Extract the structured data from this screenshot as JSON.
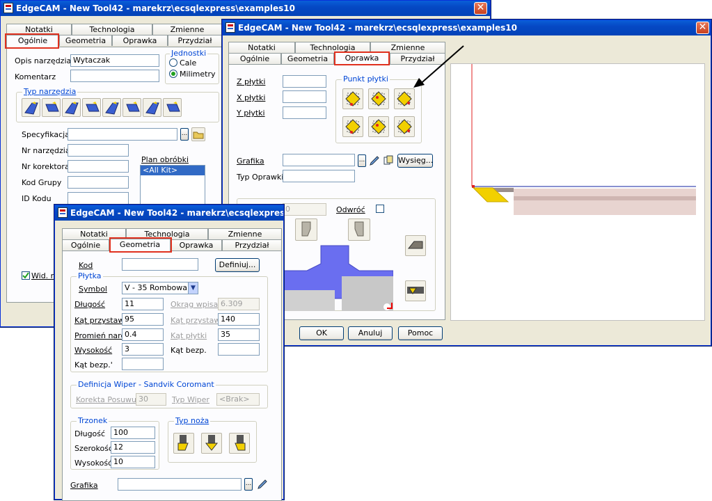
{
  "win1": {
    "title": "EdgeCAM - New Tool42 - marekrz\\ecsqlexpress\\examples10",
    "tabs_row1": [
      "Notatki",
      "Technologia",
      "Zmienne"
    ],
    "tabs_row2": [
      "Ogólnie",
      "Geometria",
      "Oprawka",
      "Przydział"
    ],
    "opis_label": "Opis narzędzia",
    "opis_value": "Wytaczak",
    "komentarz_label": "Komentarz",
    "jednostki_title": "Jednostki",
    "cale": "Cale",
    "milimetry": "Milimetry",
    "typ_title": "Typ narzędzia",
    "specyfikacja": "Specyfikacja",
    "nr_narzedzia": "Nr narzędzia",
    "nr_korektora": "Nr korektora",
    "kod_grupy": "Kod Grupy",
    "id_kodu": "ID Kodu",
    "plan_label": "Plan obróbki",
    "plan_item": "<All Kit>",
    "wid_label": "Wid. na",
    "dots": "..."
  },
  "win2": {
    "title": "EdgeCAM - New Tool42 - marekrz\\ecsqlexpress\\examples10",
    "tabs_row1": [
      "Notatki",
      "Technologia",
      "Zmienne"
    ],
    "tabs_row2": [
      "Ogólnie",
      "Geometria",
      "Oprawka",
      "Przydział"
    ],
    "z_plytki": "Z płytki",
    "x_plytki": "X płytki",
    "y_plytki": "Y płytki",
    "punkt_title": "Punkt płytki",
    "grafika": "Grafika",
    "typ_oprawki": "Typ Oprawki",
    "wysieg": "Wysięg...",
    "odwroc": "Odwróć",
    "partial_value": "0",
    "ok": "OK",
    "anuluj": "Anuluj",
    "pomoc": "Pomoc",
    "dots": "..."
  },
  "win3": {
    "title": "EdgeCAM - New Tool42 - marekrz\\ecsqlexpress\\examples10",
    "tabs_row1": [
      "Notatki",
      "Technologia",
      "Zmienne"
    ],
    "tabs_row2": [
      "Ogólnie",
      "Geometria",
      "Oprawka",
      "Przydział"
    ],
    "kod": "Kod",
    "definiuj": "Definiuj...",
    "plytka_title": "Płytka",
    "symbol": "Symbol",
    "symbol_value": "V - 35 Rombowa",
    "dlugosc": "Długość",
    "dlugosc_v": "11",
    "okrag": "Okrąg wpisany",
    "okrag_v": "6.309",
    "kat_przystaw": "Kąt przystaw.",
    "kat_przystaw_v": "95",
    "kat_przystaw2": "Kąt przystaw.",
    "kat_przystaw2_v": "140",
    "promien": "Promień naroża",
    "promien_v": "0.4",
    "kat_plytki": "Kąt płytki",
    "kat_plytki_v": "35",
    "wysokosc": "Wysokość",
    "wysokosc_v": "3",
    "kat_bezp": "Kąt bezp.",
    "kat_bezp2": "Kąt bezp.'",
    "wiper_title": "Definicja Wiper - Sandvik Coromant",
    "korekta": "Korekta Posuwu %",
    "korekta_v": "30",
    "typ_wiper": "Typ Wiper",
    "typ_wiper_v": "<Brak>",
    "trzonek_title": "Trzonek",
    "t_dlugosc": "Długość",
    "t_dlugosc_v": "100",
    "t_szerokosc": "Szerokość",
    "t_szerokosc_v": "12",
    "t_wysokosc": "Wysokość",
    "t_wysokosc_v": "10",
    "typ_noza_title": "Typ noża",
    "grafika": "Grafika",
    "dots": "..."
  },
  "colors": {
    "accent_red": "#e0301e",
    "title_blue": "#0548c4",
    "graphic_blue": "#6a6ef0",
    "insert_yellow": "#f2d000"
  }
}
